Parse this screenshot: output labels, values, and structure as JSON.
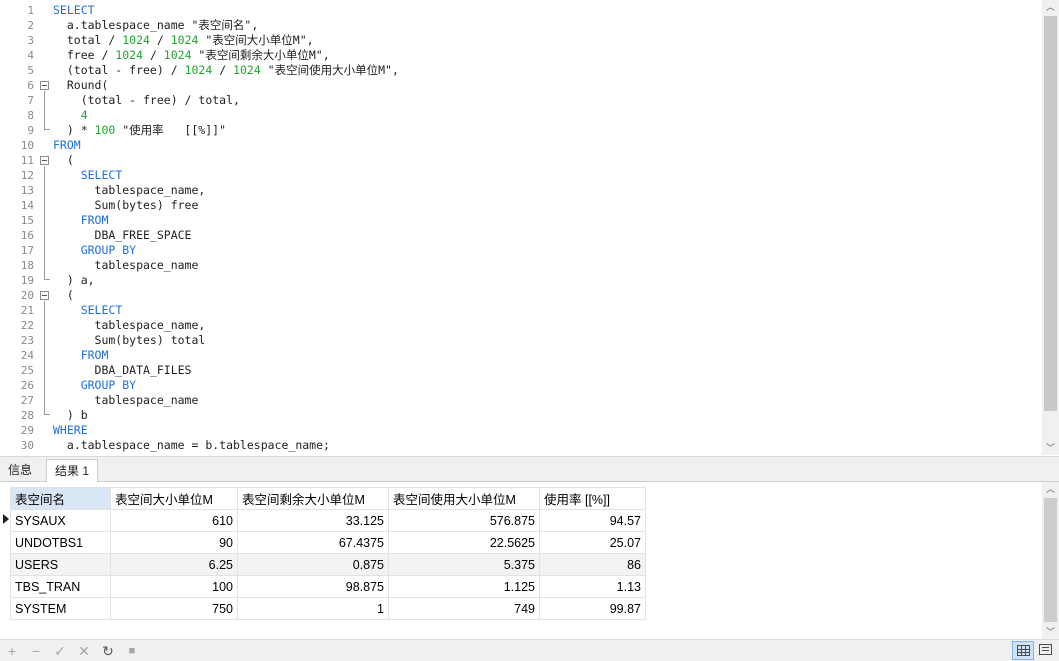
{
  "editor": {
    "line_numbers": [
      "1",
      "2",
      "3",
      "4",
      "5",
      "6",
      "7",
      "8",
      "9",
      "10",
      "11",
      "12",
      "13",
      "14",
      "15",
      "16",
      "17",
      "18",
      "19",
      "20",
      "21",
      "22",
      "23",
      "24",
      "25",
      "26",
      "27",
      "28",
      "29",
      "30"
    ],
    "lines": [
      [
        {
          "t": "SELECT",
          "c": "kw"
        }
      ],
      [
        {
          "t": "  a.tablespace_name \"表空间名\","
        }
      ],
      [
        {
          "t": "  total / "
        },
        {
          "t": "1024",
          "c": "num"
        },
        {
          "t": " / "
        },
        {
          "t": "1024",
          "c": "num"
        },
        {
          "t": " \"表空间大小单位M\","
        }
      ],
      [
        {
          "t": "  free / "
        },
        {
          "t": "1024",
          "c": "num"
        },
        {
          "t": " / "
        },
        {
          "t": "1024",
          "c": "num"
        },
        {
          "t": " \"表空间剩余大小单位M\","
        }
      ],
      [
        {
          "t": "  (total - free) / "
        },
        {
          "t": "1024",
          "c": "num"
        },
        {
          "t": " / "
        },
        {
          "t": "1024",
          "c": "num"
        },
        {
          "t": " \"表空间使用大小单位M\","
        }
      ],
      [
        {
          "t": "  Round("
        }
      ],
      [
        {
          "t": "    (total - free) / total,"
        }
      ],
      [
        {
          "t": "    "
        },
        {
          "t": "4",
          "c": "num"
        }
      ],
      [
        {
          "t": "  ) * "
        },
        {
          "t": "100",
          "c": "num"
        },
        {
          "t": " \"使用率   [[%]]\""
        }
      ],
      [
        {
          "t": "FROM",
          "c": "kw"
        }
      ],
      [
        {
          "t": "  ("
        }
      ],
      [
        {
          "t": "    "
        },
        {
          "t": "SELECT",
          "c": "kw"
        }
      ],
      [
        {
          "t": "      tablespace_name,"
        }
      ],
      [
        {
          "t": "      Sum(bytes) free"
        }
      ],
      [
        {
          "t": "    "
        },
        {
          "t": "FROM",
          "c": "kw"
        }
      ],
      [
        {
          "t": "      DBA_FREE_SPACE"
        }
      ],
      [
        {
          "t": "    "
        },
        {
          "t": "GROUP BY",
          "c": "kw"
        }
      ],
      [
        {
          "t": "      tablespace_name"
        }
      ],
      [
        {
          "t": "  ) a,"
        }
      ],
      [
        {
          "t": "  ("
        }
      ],
      [
        {
          "t": "    "
        },
        {
          "t": "SELECT",
          "c": "kw"
        }
      ],
      [
        {
          "t": "      tablespace_name,"
        }
      ],
      [
        {
          "t": "      Sum(bytes) total"
        }
      ],
      [
        {
          "t": "    "
        },
        {
          "t": "FROM",
          "c": "kw"
        }
      ],
      [
        {
          "t": "      DBA_DATA_FILES"
        }
      ],
      [
        {
          "t": "    "
        },
        {
          "t": "GROUP BY",
          "c": "kw"
        }
      ],
      [
        {
          "t": "      tablespace_name"
        }
      ],
      [
        {
          "t": "  ) b"
        }
      ],
      [
        {
          "t": "WHERE",
          "c": "kw"
        }
      ],
      [
        {
          "t": "  a.tablespace_name = b.tablespace_name;"
        }
      ]
    ]
  },
  "tabs": {
    "info": "信息",
    "result": "结果 1"
  },
  "results": {
    "columns": [
      "表空间名",
      "表空间大小单位M",
      "表空间剩余大小单位M",
      "表空间使用大小单位M",
      "使用率   [[%]]"
    ],
    "rows": [
      [
        "SYSAUX",
        "610",
        "33.125",
        "576.875",
        "94.57"
      ],
      [
        "UNDOTBS1",
        "90",
        "67.4375",
        "22.5625",
        "25.07"
      ],
      [
        "USERS",
        "6.25",
        "0.875",
        "5.375",
        "86"
      ],
      [
        "TBS_TRAN",
        "100",
        "98.875",
        "1.125",
        "1.13"
      ],
      [
        "SYSTEM",
        "750",
        "1",
        "749",
        "99.87"
      ]
    ]
  },
  "toolbar": {
    "add": "+",
    "remove": "−",
    "apply": "✓",
    "cancel": "✕",
    "refresh": "↻",
    "stop": "■"
  },
  "colors": {
    "keyword": "#1e6fd9",
    "number": "#1fa52c",
    "selected_header": "#d8e6f5"
  }
}
